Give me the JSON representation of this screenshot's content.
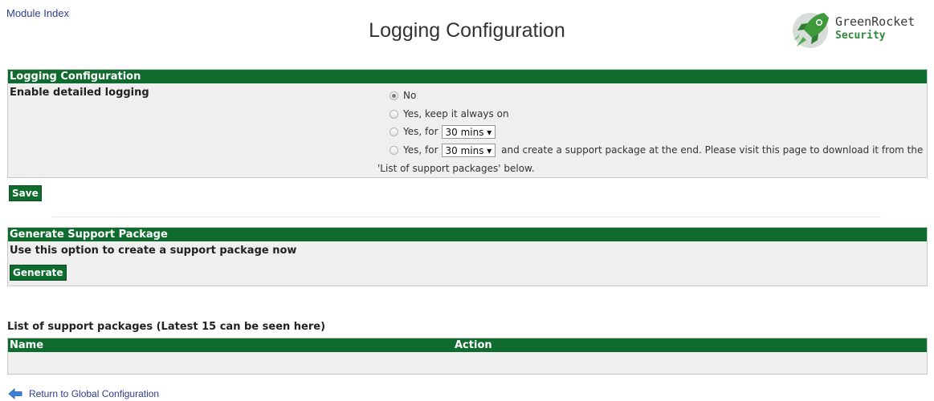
{
  "header": {
    "module_index": "Module Index",
    "title": "Logging Configuration",
    "logo_line1": "GreenRocket",
    "logo_line2": "Security",
    "logo_icon": "rocket-icon"
  },
  "logging": {
    "panel_title": "Logging Configuration",
    "field_label": "Enable detailed logging",
    "options": [
      {
        "label": "No",
        "selected": true
      },
      {
        "label": "Yes, keep it always on",
        "selected": false
      },
      {
        "prefix": "Yes, for",
        "duration": "30 mins ▾",
        "selected": false
      },
      {
        "prefix": "Yes, for",
        "duration": "30 mins ▾",
        "suffix": "and create a support package at the end. Please visit this page to download it from the",
        "line2": "'List of support packages' below.",
        "selected": false
      }
    ],
    "save_label": "Save"
  },
  "support": {
    "panel_title": "Generate Support Package",
    "description": "Use this option to create a support package now",
    "generate_label": "Generate"
  },
  "packages": {
    "title": "List of support packages (Latest 15 can be seen here)",
    "columns": [
      "Name",
      "Action"
    ]
  },
  "footer": {
    "return_label": "Return to Global Configuration",
    "return_icon": "arrow-left-icon"
  },
  "colors": {
    "header_green": "#0f6b2e",
    "panel_bg": "#efefef",
    "link_blue": "#2c3d8f"
  }
}
